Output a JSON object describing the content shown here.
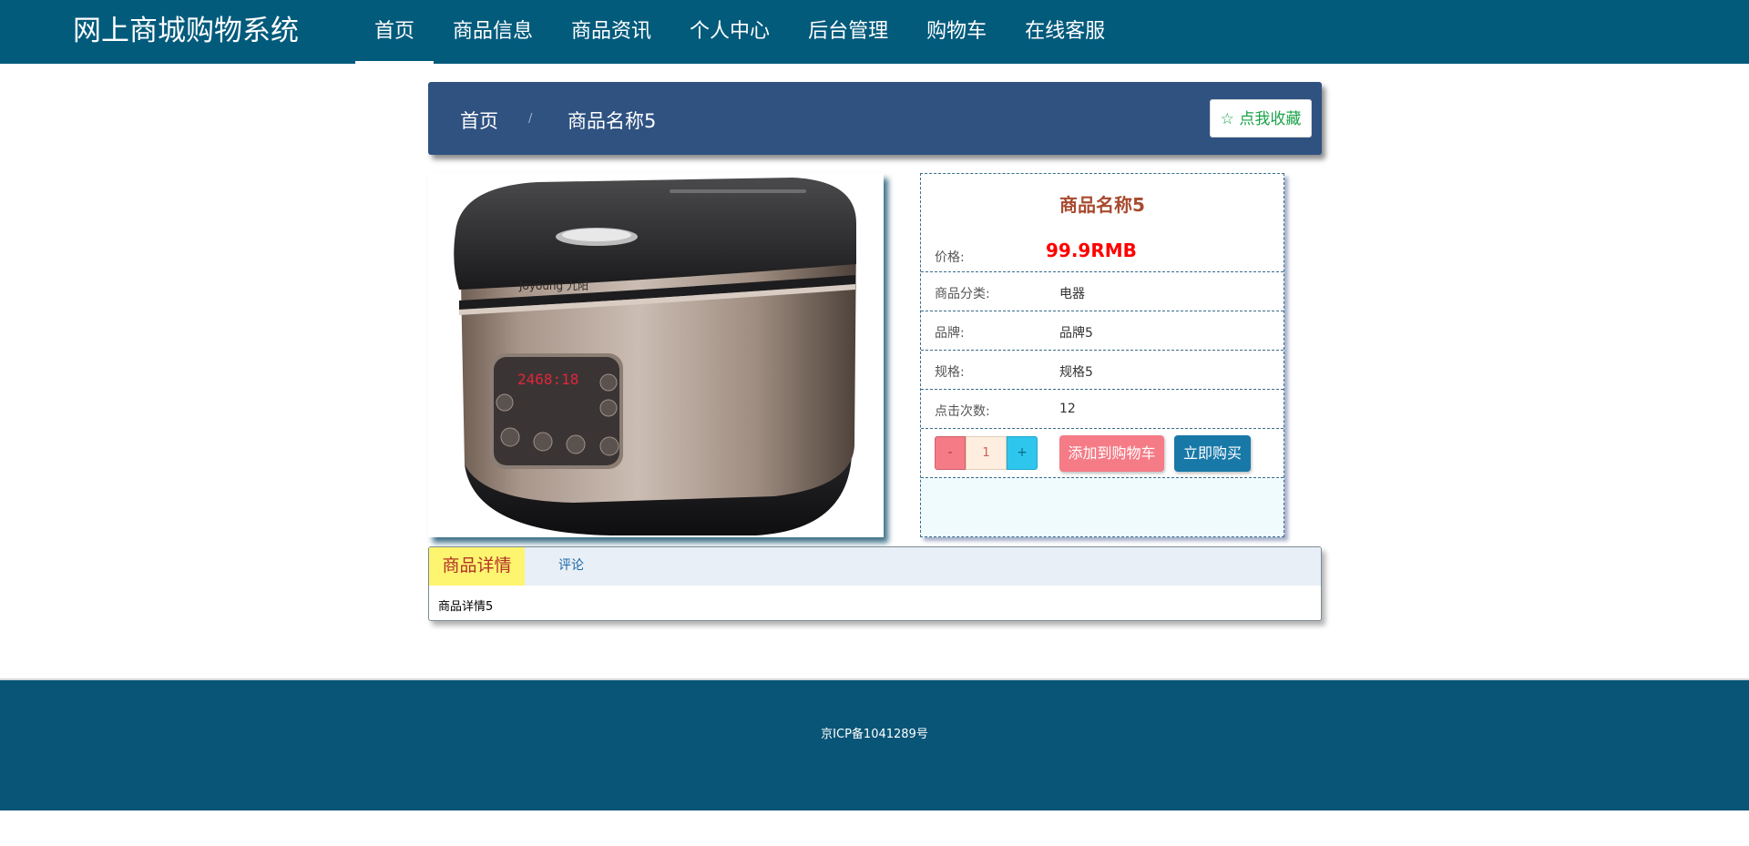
{
  "header": {
    "brand": "网上商城购物系统",
    "nav": [
      "首页",
      "商品信息",
      "商品资讯",
      "个人中心",
      "后台管理",
      "购物车",
      "在线客服"
    ],
    "active_index": 0
  },
  "breadcrumb": {
    "home": "首页",
    "separator": "/",
    "current": "商品名称5",
    "favorite_button": "☆ 点我收藏"
  },
  "product": {
    "name": "商品名称5",
    "image_subject": "rice-cooker",
    "image_brand_text": "Joyoung 九阳",
    "display_digits": "2468:18",
    "price_label": "价格:",
    "price": "99.9RMB",
    "rows": [
      {
        "label": "商品分类:",
        "value": "电器"
      },
      {
        "label": "品牌:",
        "value": "品牌5"
      },
      {
        "label": "规格:",
        "value": "规格5"
      },
      {
        "label": "点击次数:",
        "value": "12"
      }
    ],
    "quantity": {
      "minus": "-",
      "value": "1",
      "plus": "+"
    },
    "add_to_cart": "添加到购物车",
    "buy_now": "立即购买"
  },
  "tabs": {
    "items": [
      "商品详情",
      "评论"
    ],
    "active_index": 0,
    "content": "商品详情5"
  },
  "footer": {
    "icp": "京ICP备1041289号"
  },
  "colors": {
    "nav_bg": "#035b7c",
    "breadcrumb_bg": "#2f5281",
    "price": "#ff0000",
    "add_cart": "#f57b86",
    "buy_now": "#1879a8",
    "footer_bg": "#095577"
  }
}
